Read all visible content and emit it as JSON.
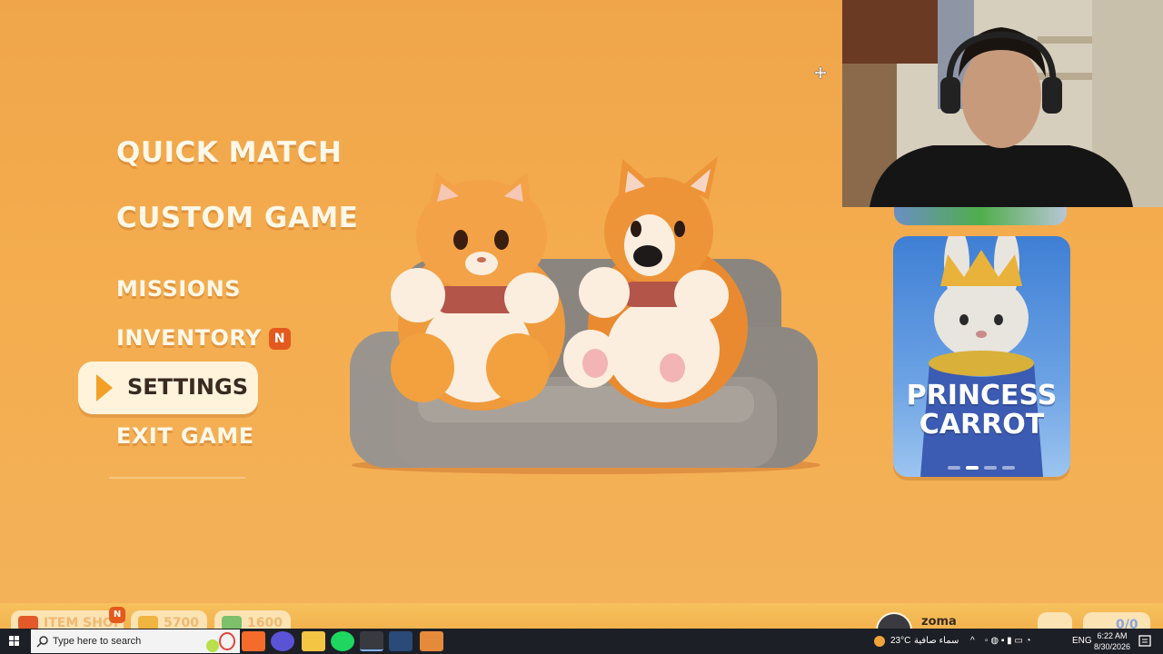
{
  "menu": {
    "items": [
      {
        "label": "QUICK MATCH"
      },
      {
        "label": "CUSTOM GAME"
      },
      {
        "label": "MISSIONS"
      },
      {
        "label": "INVENTORY",
        "badge": "N"
      },
      {
        "label": "SETTINGS",
        "selected": true
      },
      {
        "label": "EXIT GAME"
      }
    ]
  },
  "character_card": {
    "name_line1": "PRINCESS",
    "name_line2": "CARROT",
    "carousel_pages": 4,
    "carousel_active": 2
  },
  "bottom_bar": {
    "item_shop_label": "ITEM SHOP",
    "item_shop_badge": "N",
    "coins": "5700",
    "cash": "1600",
    "username": "zoma",
    "friends_count": "0/0"
  },
  "taskbar": {
    "search_placeholder": "Type here to search",
    "weather_temp": "23°C",
    "weather_text": "سماء صافية",
    "language": "ENG",
    "time": "6:22 AM",
    "date": "8/30/2026"
  },
  "colors": {
    "background": "#f0a54a",
    "menu_text": "#fff8e8",
    "accent_orange": "#f2a126",
    "badge_red": "#e45a1e",
    "card_blue": "#3f7fd4",
    "taskbar": "#1d1f26"
  }
}
